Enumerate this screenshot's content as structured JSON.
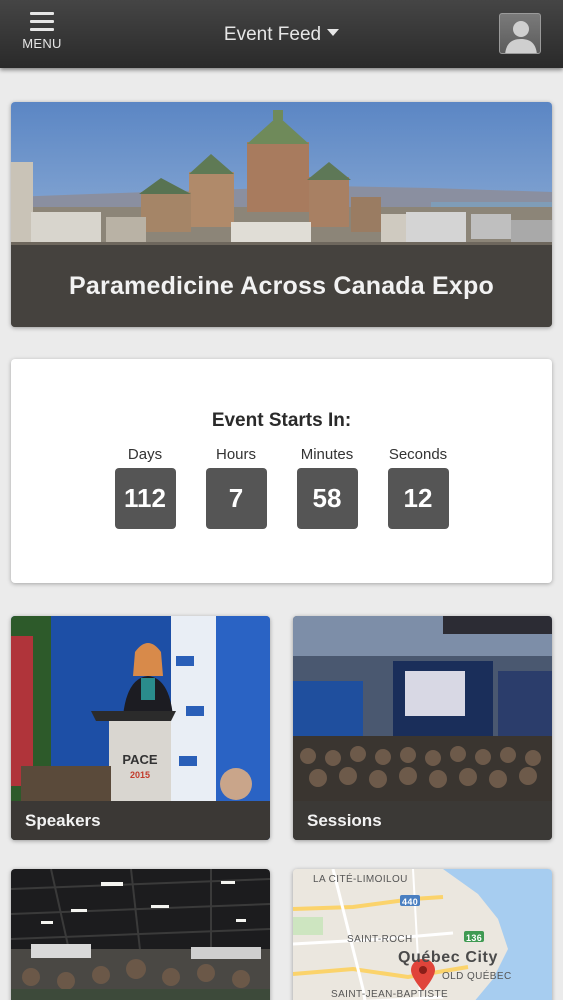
{
  "header": {
    "menu_label": "MENU",
    "title": "Event Feed",
    "icons": {
      "menu": "hamburger-icon",
      "dropdown": "caret-down-icon",
      "profile": "user-avatar-icon"
    }
  },
  "hero": {
    "title": "Paramedicine Across Canada Expo"
  },
  "countdown": {
    "title": "Event Starts In:",
    "units": [
      {
        "label": "Days",
        "value": "112"
      },
      {
        "label": "Hours",
        "value": "7"
      },
      {
        "label": "Minutes",
        "value": "58"
      },
      {
        "label": "Seconds",
        "value": "12"
      }
    ]
  },
  "tiles": {
    "speakers": {
      "label": "Speakers"
    },
    "sessions": {
      "label": "Sessions"
    }
  },
  "photo_text": {
    "podium_sign": "PACE",
    "podium_year": "2015"
  },
  "map": {
    "labels": [
      "LA CITÉ-LIMOILOU",
      "440",
      "SAINT-ROCH",
      "136",
      "Québec City",
      "OLD QUÉBEC",
      "SAINT-JEAN-BAPTISTE"
    ]
  },
  "colors": {
    "topbar": "#333333",
    "countdown_box": "#555555",
    "caption_overlay": "#3c3a37",
    "page_bg": "#ebebeb"
  }
}
